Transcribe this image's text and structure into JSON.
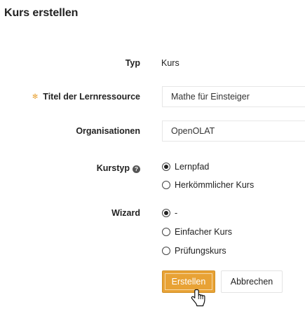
{
  "page": {
    "title": "Kurs erstellen"
  },
  "form": {
    "typ": {
      "label": "Typ",
      "value": "Kurs"
    },
    "titel": {
      "required_mark": "✻",
      "label": "Titel der Lernressource",
      "value": "Mathe für Einsteiger"
    },
    "organisationen": {
      "label": "Organisationen",
      "value": "OpenOLAT"
    },
    "kurstyp": {
      "label": "Kurstyp",
      "help_glyph": "?",
      "options": [
        {
          "label": "Lernpfad",
          "checked": true
        },
        {
          "label": "Herkömmlicher Kurs",
          "checked": false
        }
      ]
    },
    "wizard": {
      "label": "Wizard",
      "options": [
        {
          "label": "-",
          "checked": true
        },
        {
          "label": "Einfacher Kurs",
          "checked": false
        },
        {
          "label": "Prüfungskurs",
          "checked": false
        }
      ]
    }
  },
  "buttons": {
    "create_label": "Erstellen",
    "cancel_label": "Abbrechen"
  },
  "colors": {
    "accent": "#e8a235",
    "text": "#222222",
    "border": "#e7e7e7"
  },
  "icons": {
    "required": "asterisk-icon",
    "help": "help-circle-icon",
    "cursor": "hand-pointer-icon"
  }
}
